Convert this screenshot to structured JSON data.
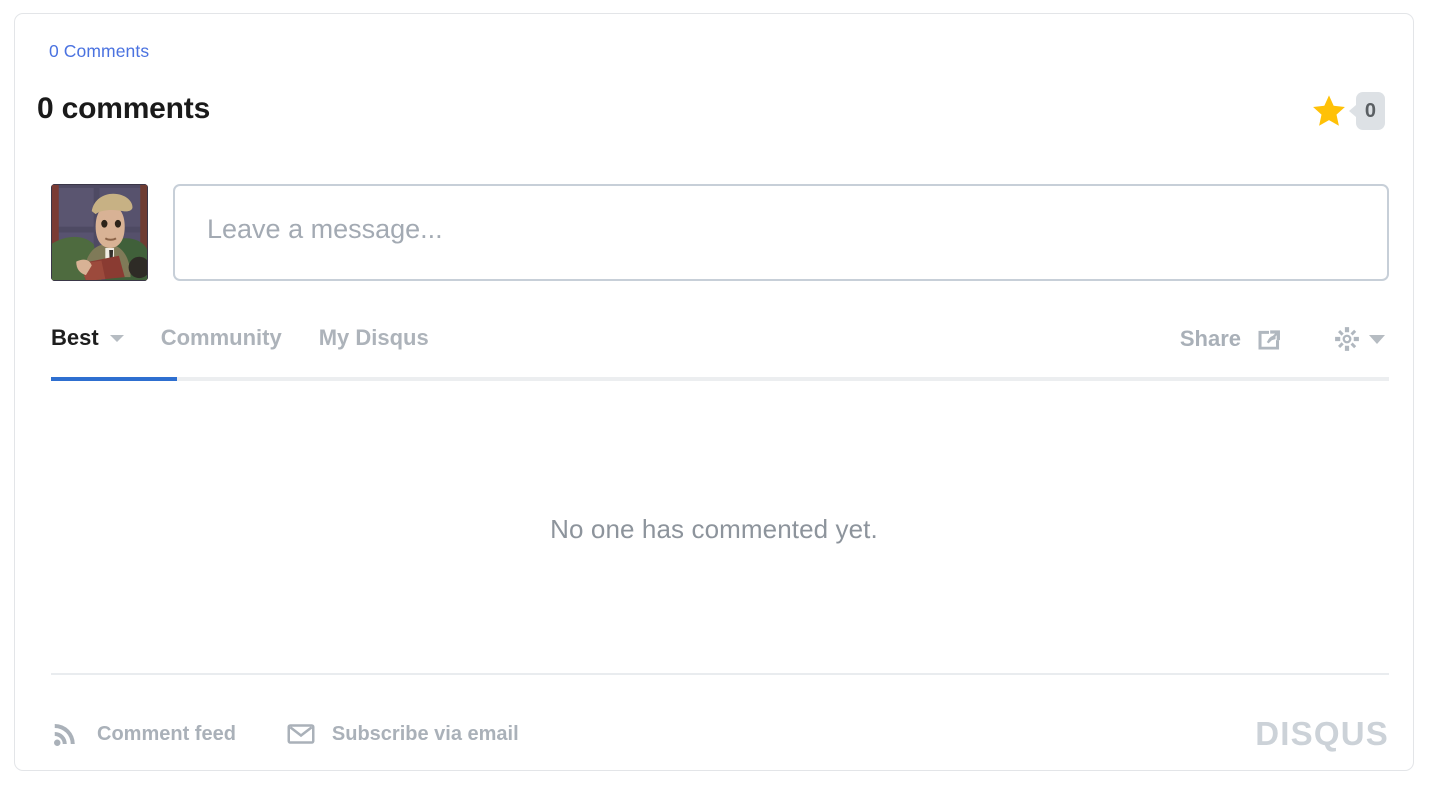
{
  "widget": {
    "name": "disqus-comments-widget",
    "comments_link_label": "0 Comments",
    "title": "0 comments",
    "brand_logo": "DISQUS"
  },
  "rating": {
    "star_icon": "star-icon",
    "vote_count": "0"
  },
  "composer": {
    "avatar_icon": "user-avatar",
    "placeholder": "Leave a message...",
    "value": ""
  },
  "tabs": [
    {
      "label": "Best",
      "active": true,
      "has_caret": true
    },
    {
      "label": "Community",
      "active": false,
      "has_caret": false
    },
    {
      "label": "My Disqus",
      "active": false,
      "has_caret": false
    }
  ],
  "tab_actions": {
    "share_label": "Share",
    "share_icon": "share-icon",
    "settings_icon": "gear-icon"
  },
  "empty_state": {
    "message": "No one has commented yet."
  },
  "footer": {
    "links": [
      {
        "label": "Comment feed",
        "icon": "rss-icon"
      },
      {
        "label": "Subscribe via email",
        "icon": "envelope-icon"
      }
    ]
  },
  "colors": {
    "link_blue": "#4a72e0",
    "active_tab_underline": "#2e6fd0",
    "star_gold": "#ffc107",
    "muted_gray": "#aab1b9",
    "logo_gray": "#ccd2d8",
    "card_border": "#e3e5e8"
  }
}
